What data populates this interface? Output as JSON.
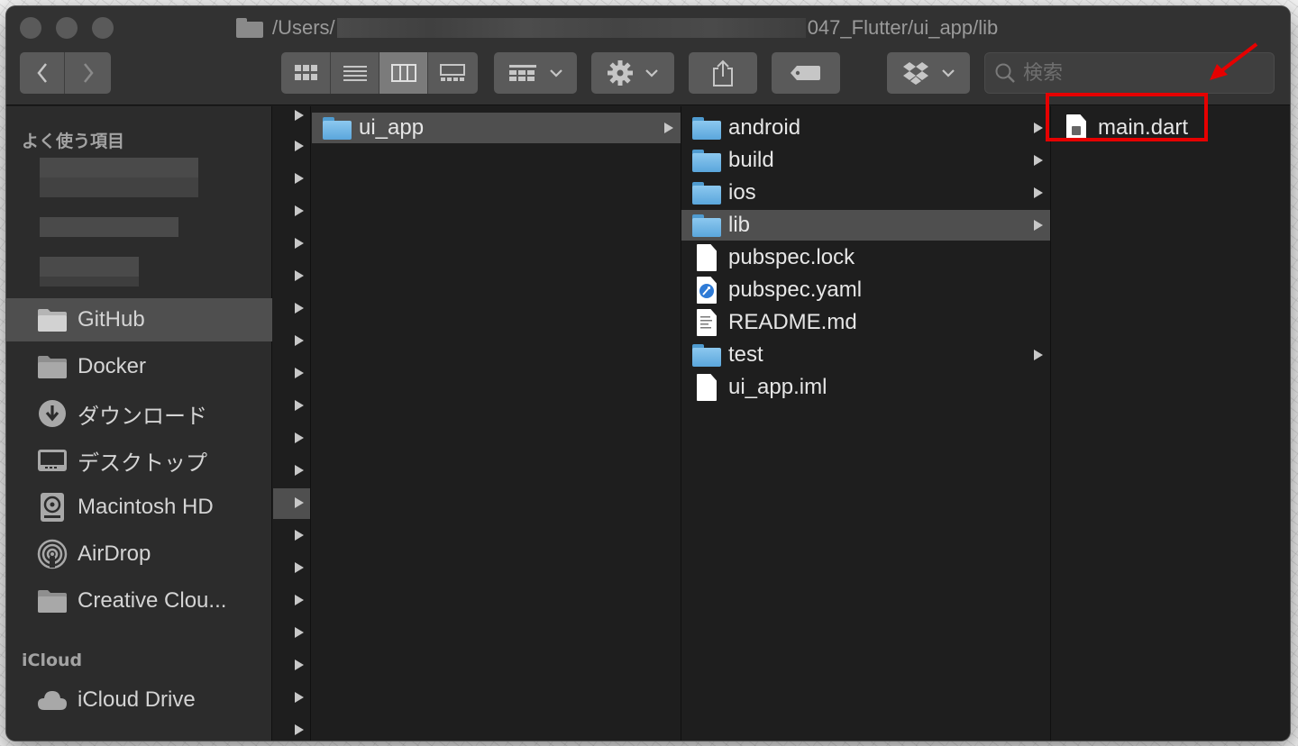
{
  "window": {
    "path_prefix": "/Users/",
    "path_suffix": "047_Flutter/ui_app/lib"
  },
  "toolbar": {
    "back_icon": "chevron-left-icon",
    "forward_icon": "chevron-right-icon",
    "view_modes": [
      "icon-view",
      "list-view",
      "column-view",
      "gallery-view"
    ],
    "active_view": "column-view",
    "search_placeholder": "検索"
  },
  "sidebar": {
    "favorites_header": "よく使う項目",
    "items": [
      {
        "label": "GitHub",
        "icon": "folder-icon",
        "selected": true
      },
      {
        "label": "Docker",
        "icon": "folder-icon",
        "selected": false
      },
      {
        "label": "ダウンロード",
        "icon": "download-icon",
        "selected": false
      },
      {
        "label": "デスクトップ",
        "icon": "desktop-icon",
        "selected": false
      },
      {
        "label": "Macintosh HD",
        "icon": "disk-icon",
        "selected": false
      },
      {
        "label": "AirDrop",
        "icon": "airdrop-icon",
        "selected": false
      },
      {
        "label": "Creative Clou...",
        "icon": "folder-icon",
        "selected": false
      }
    ],
    "icloud_header": "iCloud",
    "icloud_items": [
      {
        "label": "iCloud Drive",
        "icon": "cloud-icon"
      }
    ]
  },
  "columns": {
    "col1": [
      {
        "name": "ui_app",
        "kind": "folder",
        "selected": true
      }
    ],
    "col2": [
      {
        "name": "android",
        "kind": "folder"
      },
      {
        "name": "build",
        "kind": "folder"
      },
      {
        "name": "ios",
        "kind": "folder"
      },
      {
        "name": "lib",
        "kind": "folder",
        "selected": true
      },
      {
        "name": "pubspec.lock",
        "kind": "file"
      },
      {
        "name": "pubspec.yaml",
        "kind": "yaml-file"
      },
      {
        "name": "README.md",
        "kind": "text-file"
      },
      {
        "name": "test",
        "kind": "folder"
      },
      {
        "name": "ui_app.iml",
        "kind": "file"
      }
    ],
    "col3": [
      {
        "name": "main.dart",
        "kind": "dart-file"
      }
    ]
  },
  "annotation": {
    "color": "#e60000"
  }
}
